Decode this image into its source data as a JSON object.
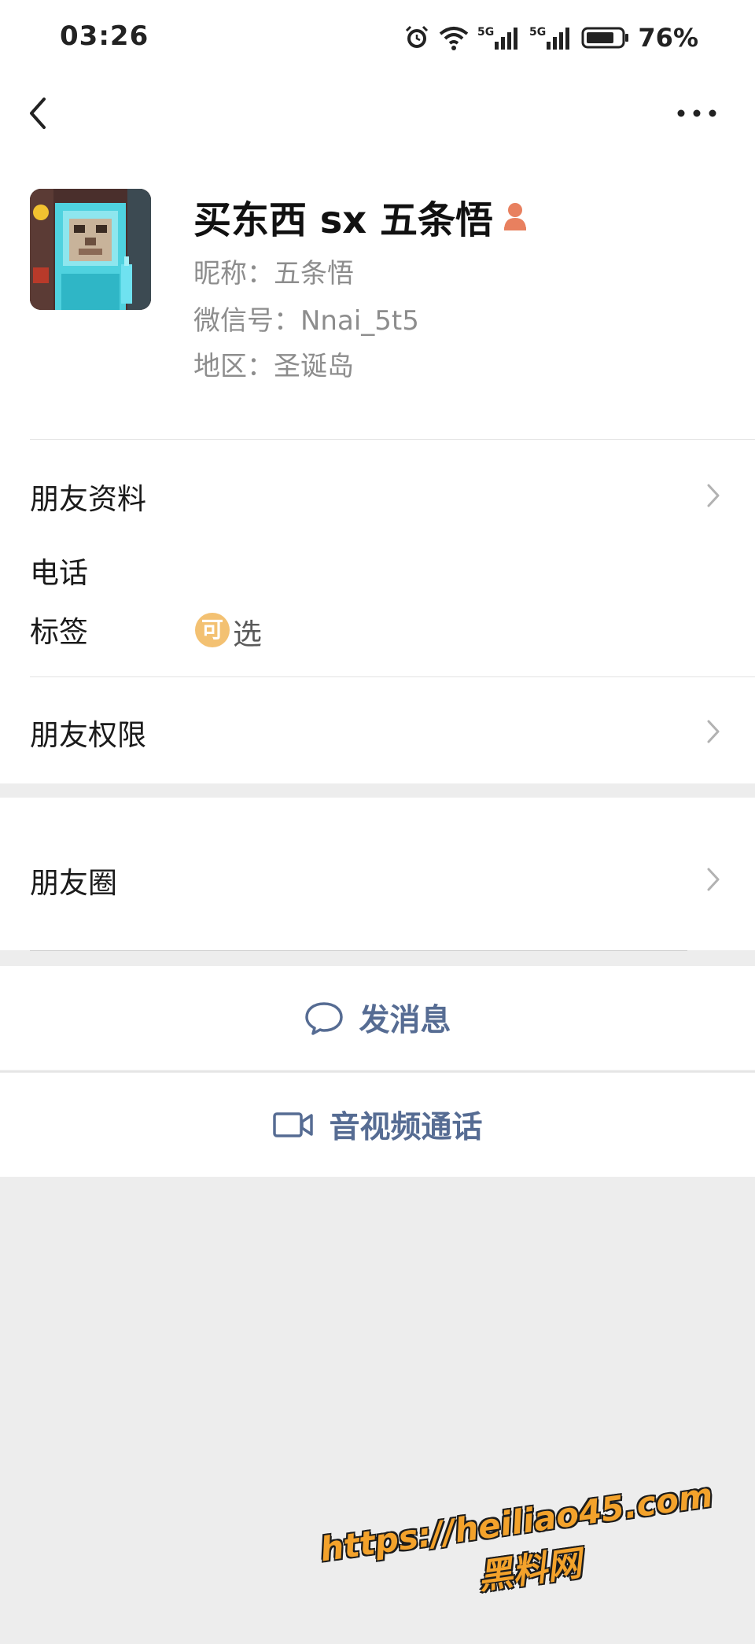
{
  "status": {
    "time": "03:26",
    "battery": "76%",
    "net1": "5G",
    "net2": "5G"
  },
  "profile": {
    "name": "买东西 sx 五条悟",
    "nickname": "昵称：五条悟",
    "wechat_id": "微信号：Nnai_5t5",
    "region": "地区：圣诞岛"
  },
  "rows": {
    "friend_info": "朋友资料",
    "phone": "电话",
    "tags": "标签",
    "tags_value_icon": "可",
    "tags_value": "选",
    "permissions": "朋友权限",
    "moments": "朋友圈"
  },
  "actions": {
    "message": "发消息",
    "call": "音视频通话"
  },
  "watermark": {
    "line1": "https://heiliao45.com",
    "line2": "黑料网"
  },
  "icons": [
    "back-arrow-icon",
    "more-icon",
    "alarm-icon",
    "wifi-icon",
    "signal-icon",
    "battery-icon",
    "gender-icon",
    "chevron-right-icon",
    "chat-bubble-icon",
    "video-camera-icon"
  ],
  "colors": {
    "link_blue": "#566c93",
    "background_gray": "#ededed",
    "tag_orange": "#f3c172",
    "gender_icon": "#e8805f"
  }
}
